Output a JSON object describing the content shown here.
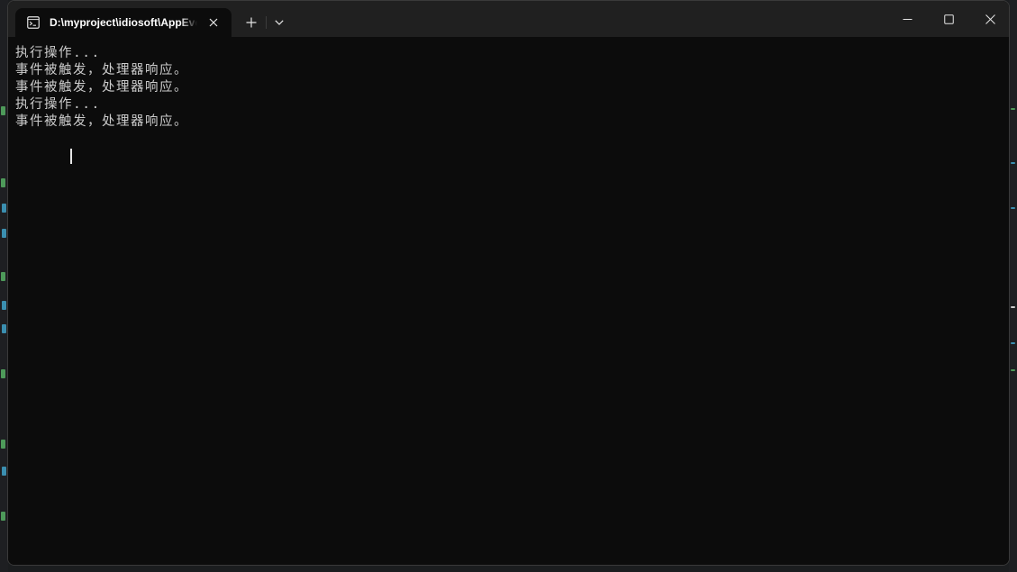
{
  "window": {
    "tab_title": "D:\\myproject\\idiosoft\\AppEvents"
  },
  "icons": {
    "tab": "terminal-icon",
    "tab_close": "close-icon",
    "new_tab": "plus-icon",
    "dropdown": "chevron-down-icon",
    "minimize": "minimize-icon",
    "maximize": "maximize-icon",
    "close": "close-icon"
  },
  "colors": {
    "terminal_bg": "#0c0c0c",
    "titlebar_bg": "#202020",
    "text": "#cccccc"
  },
  "terminal": {
    "lines": [
      "执行操作...",
      "事件被触发，处理器响应。",
      "事件被触发，处理器响应。",
      "执行操作...",
      "事件被触发，处理器响应。"
    ]
  }
}
